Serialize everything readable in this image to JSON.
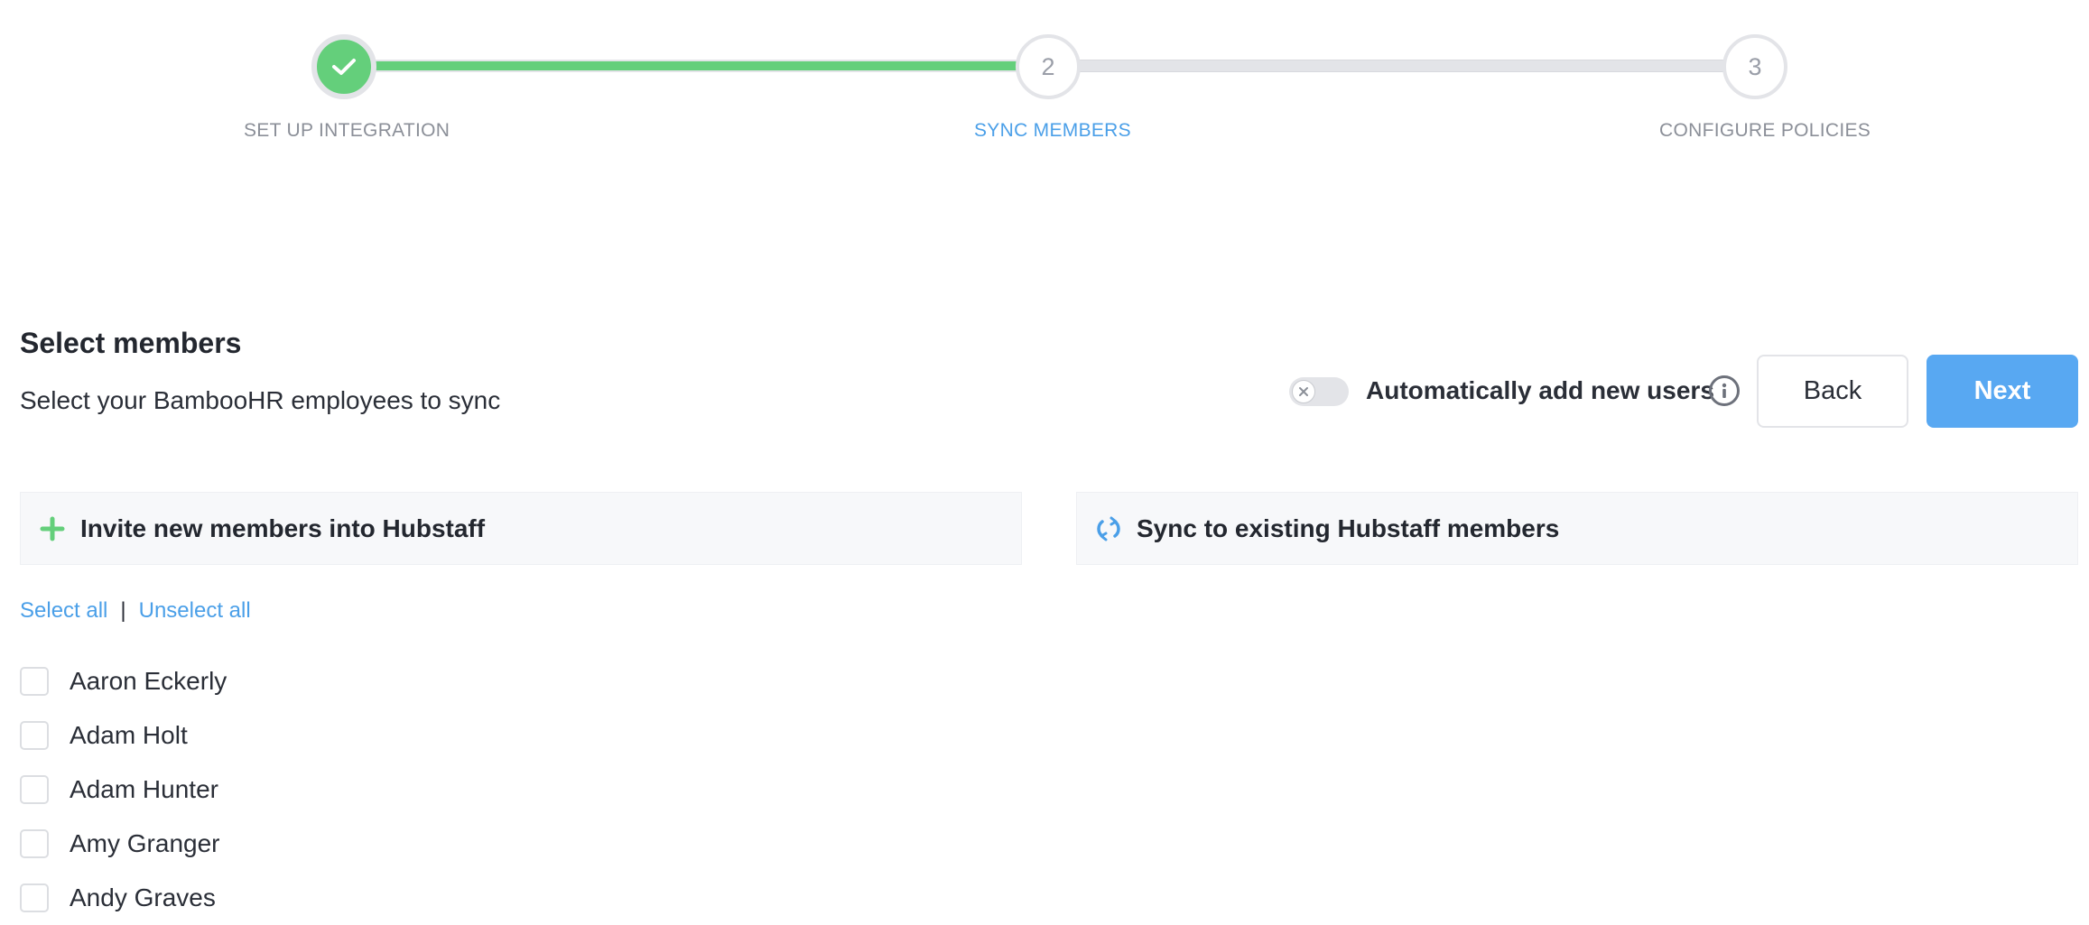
{
  "stepper": {
    "steps": [
      {
        "number": "1",
        "label": "SET UP INTEGRATION",
        "state": "completed"
      },
      {
        "number": "2",
        "label": "SYNC MEMBERS",
        "state": "active"
      },
      {
        "number": "3",
        "label": "CONFIGURE POLICIES",
        "state": "pending"
      }
    ]
  },
  "header": {
    "title": "Select members",
    "subtitle": "Select your BambooHR employees to sync"
  },
  "toolbar": {
    "auto_add_label": "Automatically add new users",
    "auto_add_enabled": false,
    "back_label": "Back",
    "next_label": "Next"
  },
  "panels": {
    "invite_label": "Invite new members into Hubstaff",
    "sync_label": "Sync to existing Hubstaff members"
  },
  "selection": {
    "select_all": "Select all",
    "separator": "|",
    "unselect_all": "Unselect all"
  },
  "members": [
    {
      "name": "Aaron Eckerly",
      "checked": false
    },
    {
      "name": "Adam Holt",
      "checked": false
    },
    {
      "name": "Adam Hunter",
      "checked": false
    },
    {
      "name": "Amy Granger",
      "checked": false
    },
    {
      "name": "Andy Graves",
      "checked": false
    }
  ],
  "colors": {
    "accent_blue": "#58a8f2",
    "success_green": "#64cf7b",
    "track_gray": "#e3e4e8"
  }
}
